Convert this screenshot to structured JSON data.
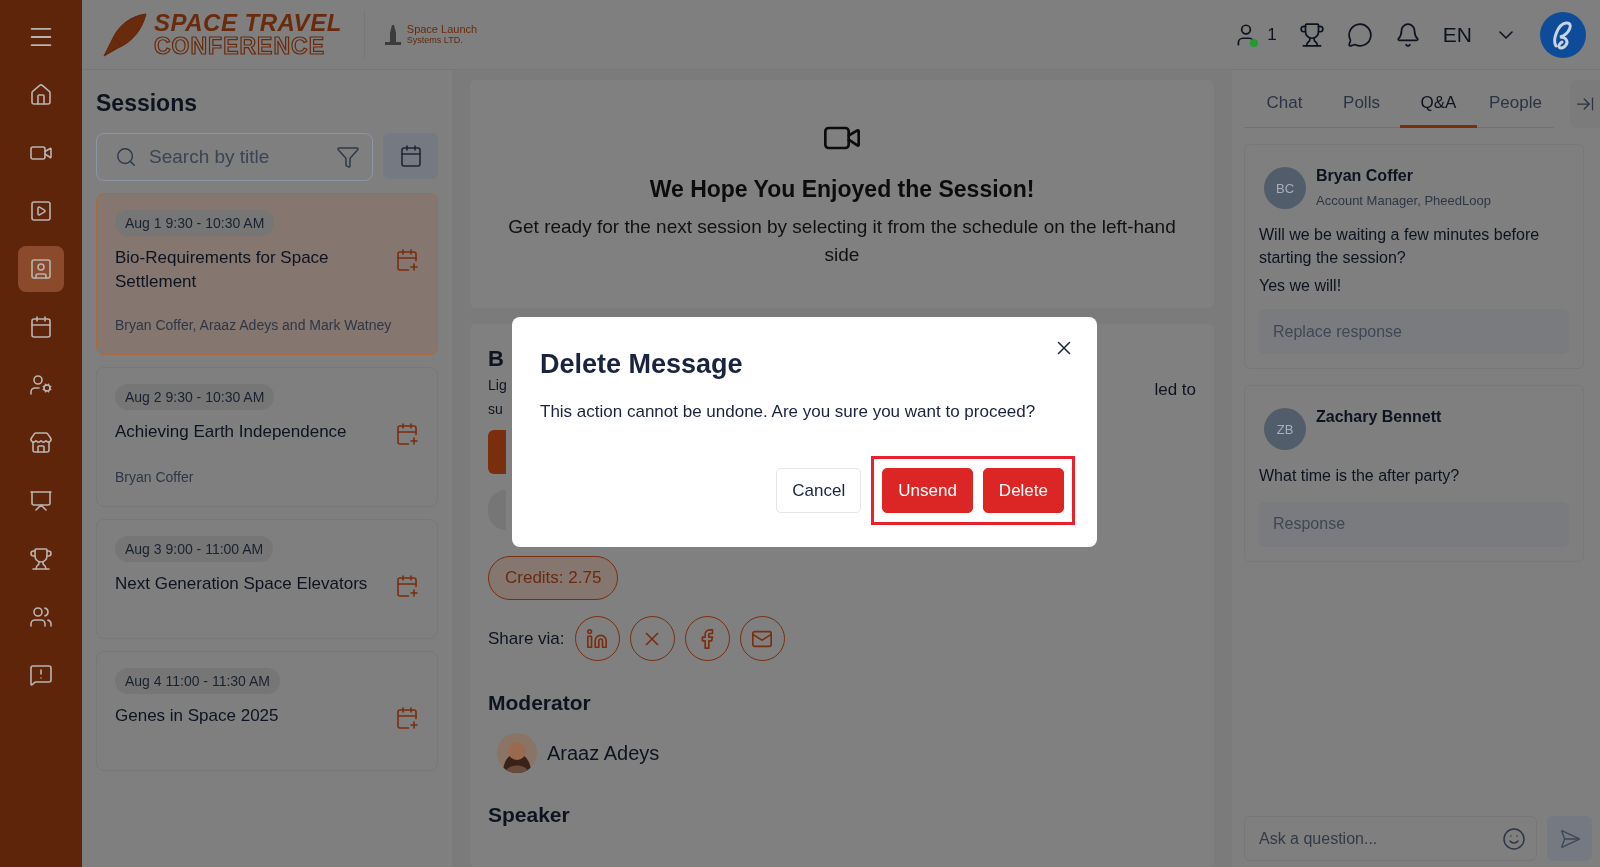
{
  "header": {
    "logo_line_1": "SPACE TRAVEL",
    "logo_line_2": "CONFERENCE",
    "sponsor_line_1": "Space Launch",
    "sponsor_line_2": "Systems LTD.",
    "online_count": "1",
    "language": "EN"
  },
  "nav_items": [
    {
      "selected": false
    },
    {
      "selected": false
    },
    {
      "selected": false
    },
    {
      "selected": true
    },
    {
      "selected": false
    },
    {
      "selected": false
    },
    {
      "selected": false
    },
    {
      "selected": false
    },
    {
      "selected": false
    },
    {
      "selected": false
    },
    {
      "selected": false
    }
  ],
  "sessions": {
    "title": "Sessions",
    "search_placeholder": "Search by title",
    "items": [
      {
        "time": "Aug 1 9:30 - 10:30 AM",
        "title": "Bio-Requirements for Space Settlement",
        "speakers": "Bryan Coffer, Araaz Adeys and Mark Watney",
        "selected": true
      },
      {
        "time": "Aug 2 9:30 - 10:30 AM",
        "title": "Achieving Earth Independence",
        "speakers": "Bryan Coffer",
        "selected": false
      },
      {
        "time": "Aug 3 9:00 - 11:00 AM",
        "title": "Next Generation Space Elevators",
        "selected": false
      },
      {
        "time": "Aug 4 11:00 - 11:30 AM",
        "title": "Genes in Space 2025",
        "selected": false
      }
    ]
  },
  "session_end": {
    "title": "We Hope You Enjoyed the Session!",
    "message": "Get ready for the next session by selecting it from the schedule on the left-hand side"
  },
  "details": {
    "title_fragment": "B",
    "text_fragments_left": [
      "Lig",
      "su"
    ],
    "text_fragment_right": "led to",
    "credits": "Credits: 2.75",
    "share_label": "Share via:",
    "moderator_heading": "Moderator",
    "moderator_name": "Araaz Adeys",
    "speaker_heading": "Speaker"
  },
  "side_panel": {
    "tabs": [
      {
        "label": "Chat",
        "selected": false
      },
      {
        "label": "Polls",
        "selected": false
      },
      {
        "label": "Q&A",
        "selected": true
      },
      {
        "label": "People",
        "selected": false
      }
    ],
    "questions": [
      {
        "initials": "BC",
        "name": "Bryan Coffer",
        "role": "Account Manager, PheedLoop",
        "question": "Will we be waiting a few minutes before starting the session?",
        "answer": "Yes we will!",
        "response_placeholder": "Replace response"
      },
      {
        "initials": "ZB",
        "name": "Zachary Bennett",
        "question": "What time is the after party?",
        "response_placeholder": "Response"
      }
    ],
    "ask_placeholder": "Ask a question..."
  },
  "dialog": {
    "title": "Delete Message",
    "message": "This action cannot be undone. Are you sure you want to proceed?",
    "buttons": [
      {
        "label": "Cancel",
        "kind": "secondary"
      }
    ],
    "highlighted_buttons": [
      {
        "label": "Unsend",
        "kind": "danger"
      },
      {
        "label": "Delete",
        "kind": "danger"
      }
    ]
  }
}
